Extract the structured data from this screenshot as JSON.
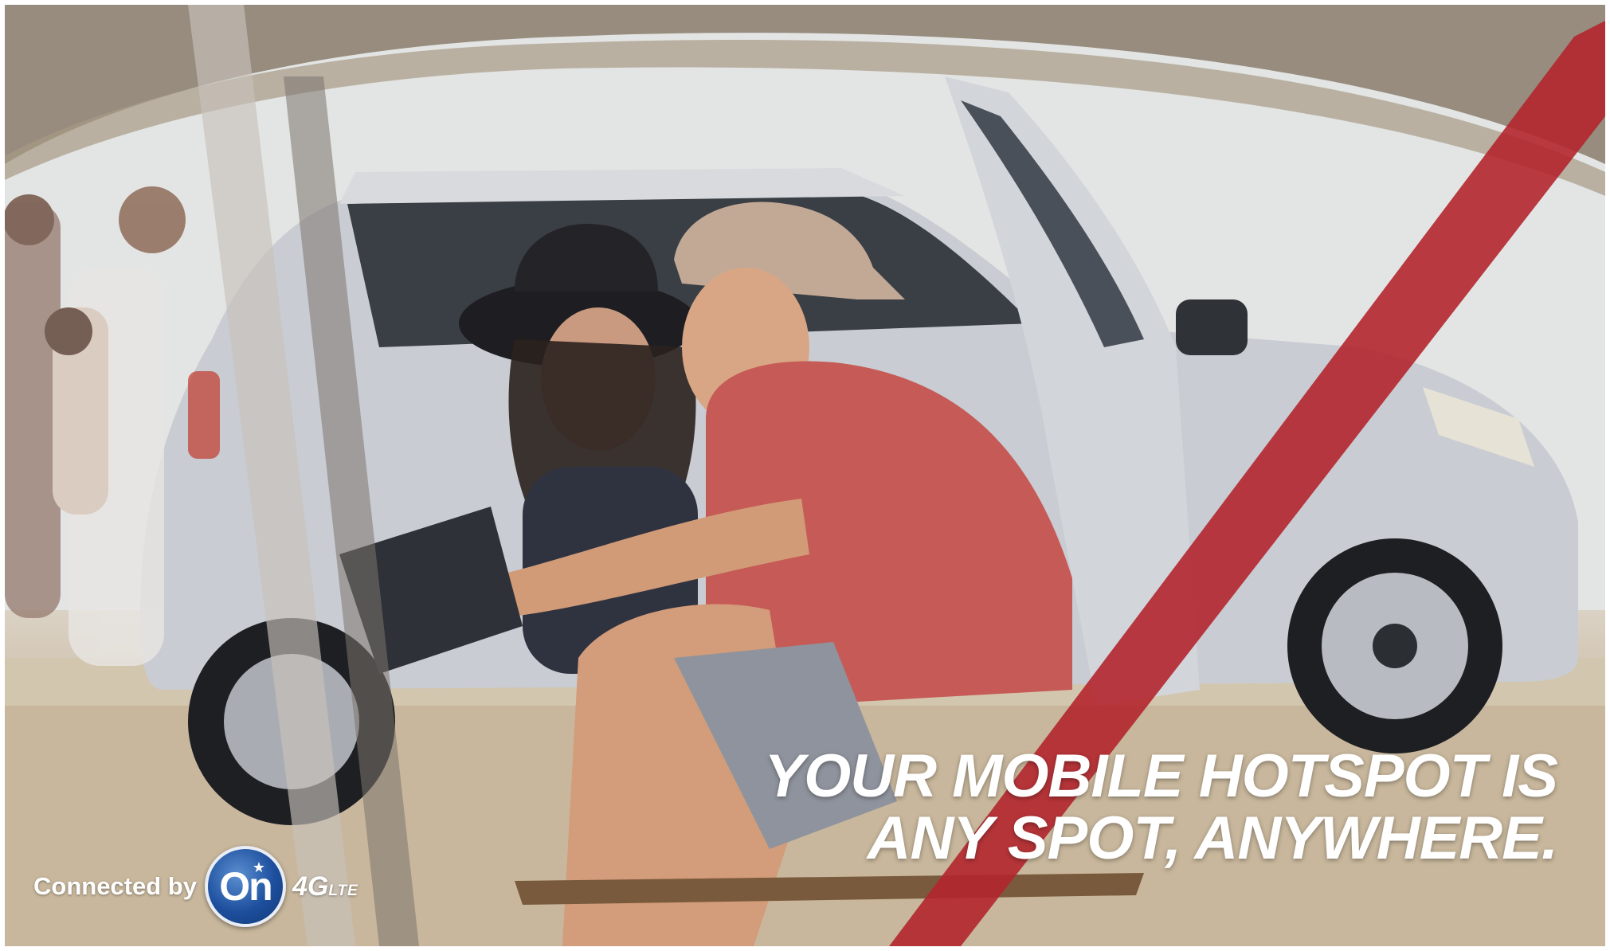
{
  "ad": {
    "headline_line1": "YOUR MOBILE HOTSPOT IS",
    "headline_line2": "ANY SPOT, ANYWHERE."
  },
  "branding": {
    "connected_by": "Connected by",
    "logo_word": "On",
    "network_main": "4G",
    "network_sub": "LTE"
  },
  "colors": {
    "text": "#ffffff",
    "logo_blue": "#1d4f9e",
    "pole_red": "#b3262e",
    "car_silver": "#c9ccd2"
  },
  "icons": [
    "onstar-logo-icon",
    "star-icon"
  ]
}
